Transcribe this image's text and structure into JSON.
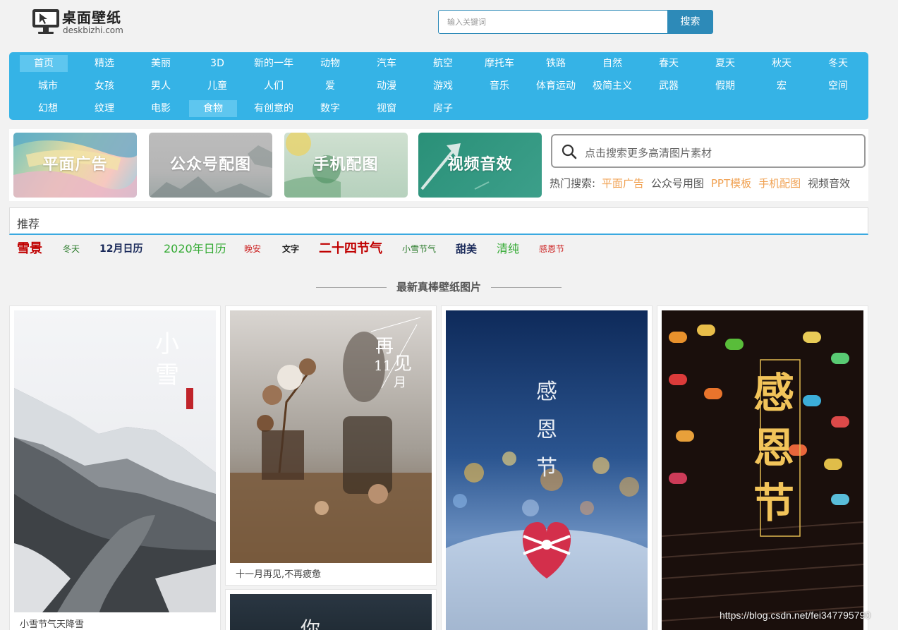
{
  "header": {
    "logo_title": "桌面壁纸",
    "logo_domain": "deskbizhi.com",
    "search_placeholder": "输入关键词",
    "search_button": "搜索"
  },
  "nav": {
    "rows": [
      [
        "首页",
        "精选",
        "美丽",
        "3D",
        "新的一年",
        "动物",
        "汽车",
        "航空",
        "摩托车",
        "铁路",
        "自然",
        "春天",
        "夏天",
        "秋天",
        "冬天"
      ],
      [
        "城市",
        "女孩",
        "男人",
        "儿童",
        "人们",
        "爱",
        "动漫",
        "游戏",
        "音乐",
        "体育运动",
        "极简主义",
        "武器",
        "假期",
        "宏",
        "空间"
      ],
      [
        "幻想",
        "纹理",
        "电影",
        "食物",
        "有创意的",
        "数字",
        "视窗",
        "房子"
      ]
    ],
    "active": [
      "首页",
      "食物"
    ]
  },
  "banner": {
    "tiles": [
      "平面广告",
      "公众号配图",
      "手机配图",
      "视频音效"
    ],
    "search_text": "点击搜索更多高清图片素材",
    "hot_label": "热门搜索:",
    "hot_items": [
      {
        "label": "平面广告",
        "highlight": true
      },
      {
        "label": "公众号用图",
        "highlight": false
      },
      {
        "label": "PPT模板",
        "highlight": true
      },
      {
        "label": "手机配图",
        "highlight": true
      },
      {
        "label": "视频音效",
        "highlight": false
      }
    ]
  },
  "recommend": {
    "title": "推荐",
    "tags": [
      {
        "label": "雪景",
        "color": "#c00000"
      },
      {
        "label": "冬天",
        "color": "#2a7a2a"
      },
      {
        "label": "12月日历",
        "color": "#1a2a5a"
      },
      {
        "label": "2020年日历",
        "color": "#33aa33"
      },
      {
        "label": "晚安",
        "color": "#cc2222"
      },
      {
        "label": "文字",
        "color": "#222222"
      },
      {
        "label": "二十四节气",
        "color": "#c00000"
      },
      {
        "label": "小雪节气",
        "color": "#2a7a2a"
      },
      {
        "label": "甜美",
        "color": "#1a2a5a"
      },
      {
        "label": "清纯",
        "color": "#33aa33"
      },
      {
        "label": "感恩节",
        "color": "#cc2222"
      }
    ]
  },
  "section_title": "最新真棒壁纸图片",
  "cards": [
    {
      "caption": "小雪节气天降雪",
      "overlay": [
        "小",
        "雪"
      ]
    },
    {
      "caption": "十一月再见,不再疲惫",
      "overlay": [
        "再",
        "见",
        "11",
        "月"
      ]
    },
    {
      "caption": "",
      "overlay": [
        "感",
        "恩",
        "节"
      ]
    },
    {
      "caption": "",
      "overlay": [
        "感",
        "恩",
        "节"
      ]
    },
    {
      "caption": "",
      "overlay": [
        "你"
      ]
    }
  ],
  "watermark": "https://blog.csdn.net/fei347795790"
}
